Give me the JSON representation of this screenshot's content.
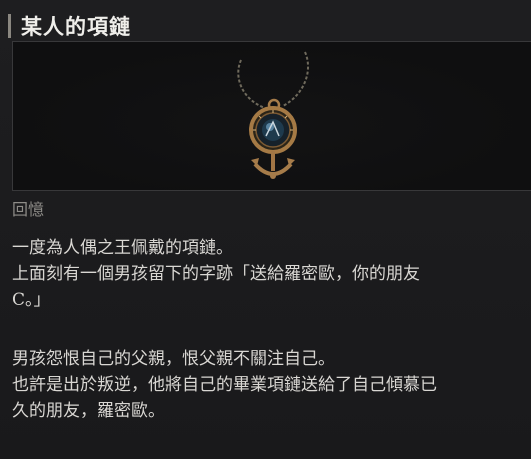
{
  "item": {
    "title": "某人的項鏈",
    "category": "回憶",
    "image_icon": "anchor-pendant-necklace-icon",
    "description_block1": [
      "一度為人偶之王佩戴的項鏈。",
      "上面刻有一個男孩留下的字跡「送給羅密歐，你的朋友",
      "C。」"
    ],
    "description_block2": [
      "男孩怨恨自己的父親，恨父親不關注自己。",
      "也許是出於叛逆，他將自己的畢業項鏈送給了自己傾慕已",
      "久的朋友，羅密歐。"
    ]
  }
}
